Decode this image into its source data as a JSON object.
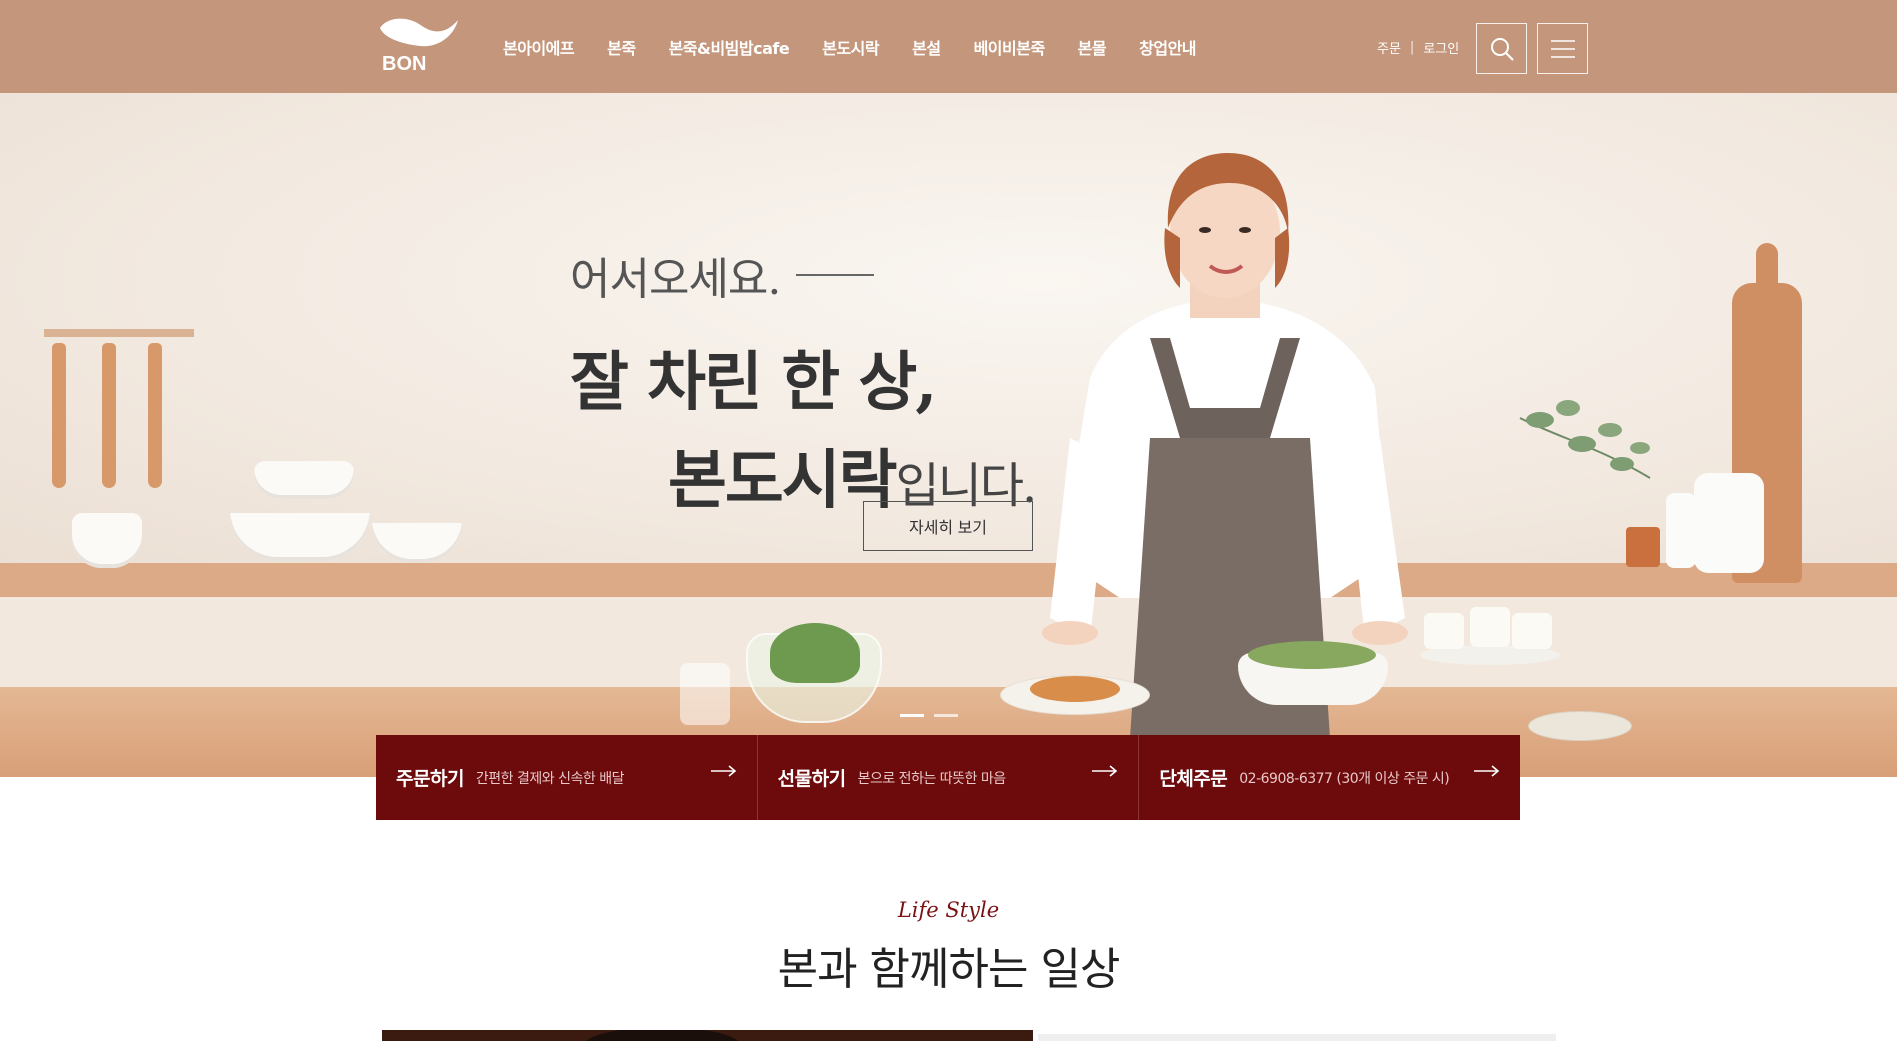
{
  "header": {
    "logo_text": "BON",
    "nav": [
      "본아이에프",
      "본죽",
      "본죽&비빔밥cafe",
      "본도시락",
      "본설",
      "베이비본죽",
      "본몰",
      "창업안내"
    ],
    "util": {
      "order": "주문",
      "separator": "|",
      "login": "로그인"
    },
    "icons": {
      "search": "search-icon",
      "menu": "hamburger-menu-icon"
    }
  },
  "hero": {
    "welcome": "어서오세요.",
    "headline_line1": "잘 차린 한 상,",
    "headline_line2": "본도시락",
    "headline_line2_suffix": "입니다.",
    "detail_button": "자세히 보기",
    "slides_total": 2,
    "slide_active": 1
  },
  "actions": [
    {
      "title": "주문하기",
      "desc": "간편한 결제와 신속한 배달"
    },
    {
      "title": "선물하기",
      "desc": "본으로 전하는 따뜻한 마음"
    },
    {
      "title": "단체주문",
      "desc": "02-6908-6377 (30개 이상 주문 시)"
    }
  ],
  "lifestyle": {
    "subtitle": "Life Style",
    "title": "본과 함께하는 일상"
  },
  "colors": {
    "header_bg": "#c4967b",
    "action_bg": "#6d0a0c",
    "accent_text": "#7a1115"
  }
}
